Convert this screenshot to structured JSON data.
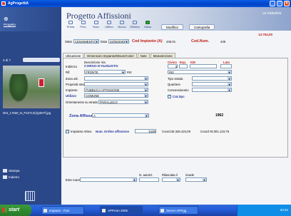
{
  "window": {
    "title": "AgProgettiA"
  },
  "sidebar": {
    "section_label": "Progetto",
    "counter": "3 di 7",
    "photo_filename": "004_17500_N_P10712(2)p00?f.jpg",
    "stampa": "Stampa",
    "indietro": "Indietro"
  },
  "header": {
    "app_title": "Progetto Affissioni",
    "right_text": "ce Industria"
  },
  "toolbar": {
    "items": [
      "Prima",
      "Prec.",
      "Succ.",
      "Ultimo",
      "Nuovo",
      "Elimina",
      "Salva"
    ],
    "modifica": "Modifica",
    "cartografia": "Cartografia"
  },
  "form": {
    "total_value": "13.754,00",
    "stato_label": "Stato",
    "stato_value": "CENSIMENTO",
    "data_label": "Data",
    "data_value": "22/05/2003",
    "cod_impianto_a_label": "Cod Impianto (A)",
    "cod_impianto_a_value": "445.01",
    "cod_num_label": "Cod.Num.",
    "cod_num_value": "445",
    "tabs": [
      "Ubicazione",
      "Dimensioni Impianto/Misure/Colori",
      "Note",
      "Manutenzione"
    ],
    "descrizione_via_label": "Descrizione Via",
    "civico_label": "Civico",
    "esp_label": "Esp.",
    "km_label": "KM",
    "lato_label": "Lato",
    "indirizzo_label": "Indirizzo",
    "indirizzo_value": "CORSO D'AUGUSTO",
    "civico_value": "3",
    "rif_label": "Rif.",
    "rif_value": "FRONTE",
    "rif_num": "IN2",
    "rif_num2": "IN3",
    "zona_uti_label": "Zona util.",
    "tipo_strada_label": "Tipo strada",
    "proprieta_label": "Proprietà strada",
    "quartiere_label": "Quartiere",
    "impianto_label": "Impianto",
    "impianto_value": "PUBBLICA AFFISSIONE",
    "concessionario_label": "Concessionario",
    "utilizzo_label": "Utilizzo",
    "utilizzo_value": "COMUNE",
    "cat_spc_label": "Cat.Spc",
    "orientamento_label": "Orientamento su strada",
    "orientamento_value": "PARALLELO",
    "zona_affissa_label": "Zona Affissa",
    "zona_affissa_value": "A",
    "year_value": "1962",
    "impianto_attivo_label": "Impianto Attivo",
    "num_ordine_label": "Num. Ordine affissione",
    "num_ordine_value": "5190",
    "coord_x_label": "Coord.X",
    "coord_x_value": "2.325.424,00",
    "coord_y_label": "Coord.Y",
    "coord_y_value": "4.001.123,75",
    "n_autoriz_label": "N. autoriz.",
    "rilasciata_label": "Rilasciata il",
    "scade_label": "Scade",
    "ente_autoriz_label": "Ente Autoriz."
  },
  "taskbar": {
    "start": "start",
    "tasks": [
      "Impianti - Fiori",
      "APProm 2005",
      "Server APPgg"
    ],
    "clock": "20:34"
  }
}
